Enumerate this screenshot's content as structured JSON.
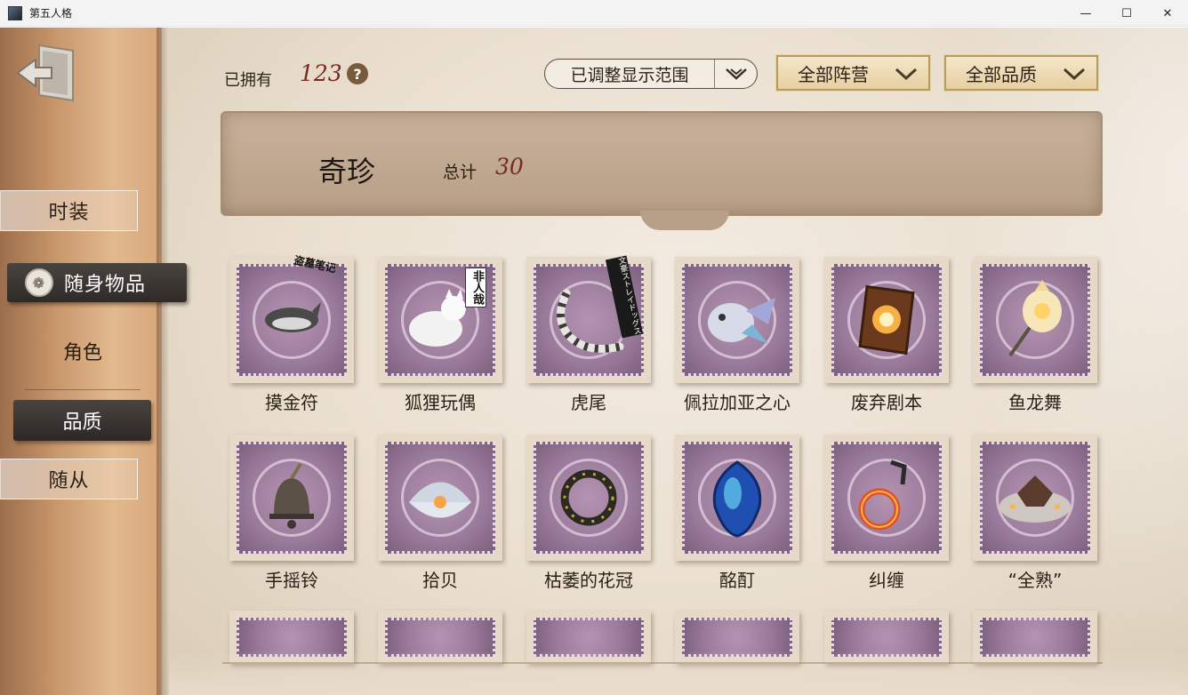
{
  "window": {
    "title": "第五人格",
    "controls": {
      "minimize": "—",
      "maximize": "☐",
      "close": "✕"
    }
  },
  "sidebar": {
    "back_icon": "exit-door-icon",
    "tabs": [
      {
        "label": "时装",
        "state": "outline"
      },
      {
        "label": "随身物品",
        "state": "active",
        "icon": "shield-emblem-icon"
      },
      {
        "label": "角色",
        "state": "plain"
      },
      {
        "label": "品质",
        "state": "selected-sub"
      },
      {
        "label": "随从",
        "state": "outline"
      }
    ]
  },
  "header": {
    "owned_label": "已拥有",
    "owned_count": "123",
    "help_icon": "?",
    "range_dropdown": "已调整显示范围",
    "camp_filter": "全部阵营",
    "quality_filter": "全部品质"
  },
  "banner": {
    "title": "奇珍",
    "total_label": "总计",
    "total_value": "30"
  },
  "items": [
    {
      "name": "摸金符",
      "icon": "shark-charm-icon",
      "tag": "盗墓笔记"
    },
    {
      "name": "狐狸玩偶",
      "icon": "fox-plush-icon",
      "tag": "非人哉"
    },
    {
      "name": "虎尾",
      "icon": "tiger-tail-icon",
      "tag": "文豪ストレイドッグス"
    },
    {
      "name": "佩拉加亚之心",
      "icon": "crystal-fish-icon",
      "tag": ""
    },
    {
      "name": "废弃剧本",
      "icon": "burning-book-icon",
      "tag": ""
    },
    {
      "name": "鱼龙舞",
      "icon": "lantern-fish-icon",
      "tag": ""
    },
    {
      "name": "手摇铃",
      "icon": "hand-bell-icon",
      "tag": ""
    },
    {
      "name": "拾贝",
      "icon": "pearl-shell-icon",
      "tag": ""
    },
    {
      "name": "枯萎的花冠",
      "icon": "withered-wreath-icon",
      "tag": ""
    },
    {
      "name": "酩酊",
      "icon": "blue-heart-gem-icon",
      "tag": ""
    },
    {
      "name": "纠缠",
      "icon": "fire-ring-icon",
      "tag": ""
    },
    {
      "name": "“全熟”",
      "icon": "steak-plate-icon",
      "tag": ""
    }
  ],
  "colors": {
    "accent_red": "#7a2a22",
    "stamp_purple": "#9a7a9a",
    "dark_tab": "#2e2a27"
  }
}
